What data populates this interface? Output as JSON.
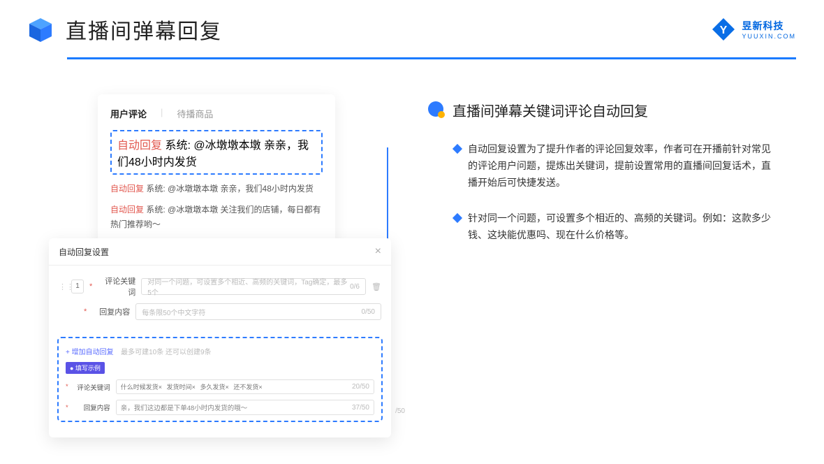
{
  "header": {
    "title": "直播间弹幕回复",
    "brand_name": "昱新科技",
    "brand_url": "YUUXIN.COM"
  },
  "comments": {
    "tab_active": "用户评论",
    "tab_inactive": "待播商品",
    "items": [
      {
        "tag": "自动回复",
        "text": "系统: @冰墩墩本墩 亲亲，我们48小时内发货"
      },
      {
        "tag": "自动回复",
        "text": "系统: @冰墩墩本墩 亲亲，我们48小时内发货"
      },
      {
        "tag": "自动回复",
        "text": "系统: @冰墩墩本墩 关注我们的店铺，每日都有热门推荐哟～"
      }
    ]
  },
  "settings": {
    "title": "自动回复设置",
    "close": "×",
    "seq": "1",
    "field1_label": "评论关键词",
    "field1_placeholder": "对同一个问题，可设置多个相近、高频的关键词，Tag确定，最多5个",
    "field1_counter": "0/6",
    "field2_label": "回复内容",
    "field2_placeholder": "每条限50个中文字符",
    "field2_counter": "0/50",
    "add_label": "+ 增加自动回复",
    "add_hint": "最多可建10条 还可以创建9条",
    "example_badge": "● 填写示例",
    "ex_field1_label": "评论关键词",
    "ex_tags": [
      "什么时候发货×",
      "发货时间×",
      "多久发货×",
      "还不发货×"
    ],
    "ex_field1_counter": "20/50",
    "ex_field2_label": "回复内容",
    "ex_field2_value": "亲，我们这边都是下单48小时内发货的哦～",
    "ex_field2_counter": "37/50",
    "outside_counter": "/50"
  },
  "right": {
    "section_title": "直播间弹幕关键词评论自动回复",
    "bullets": [
      "自动回复设置为了提升作者的评论回复效率，作者可在开播前针对常见的评论用户问题，提炼出关键词，提前设置常用的直播间回复话术，直播开始后可快捷发送。",
      "针对同一个问题，可设置多个相近的、高频的关键词。例如：这款多少钱、这块能优惠吗、现在什么价格等。"
    ]
  }
}
